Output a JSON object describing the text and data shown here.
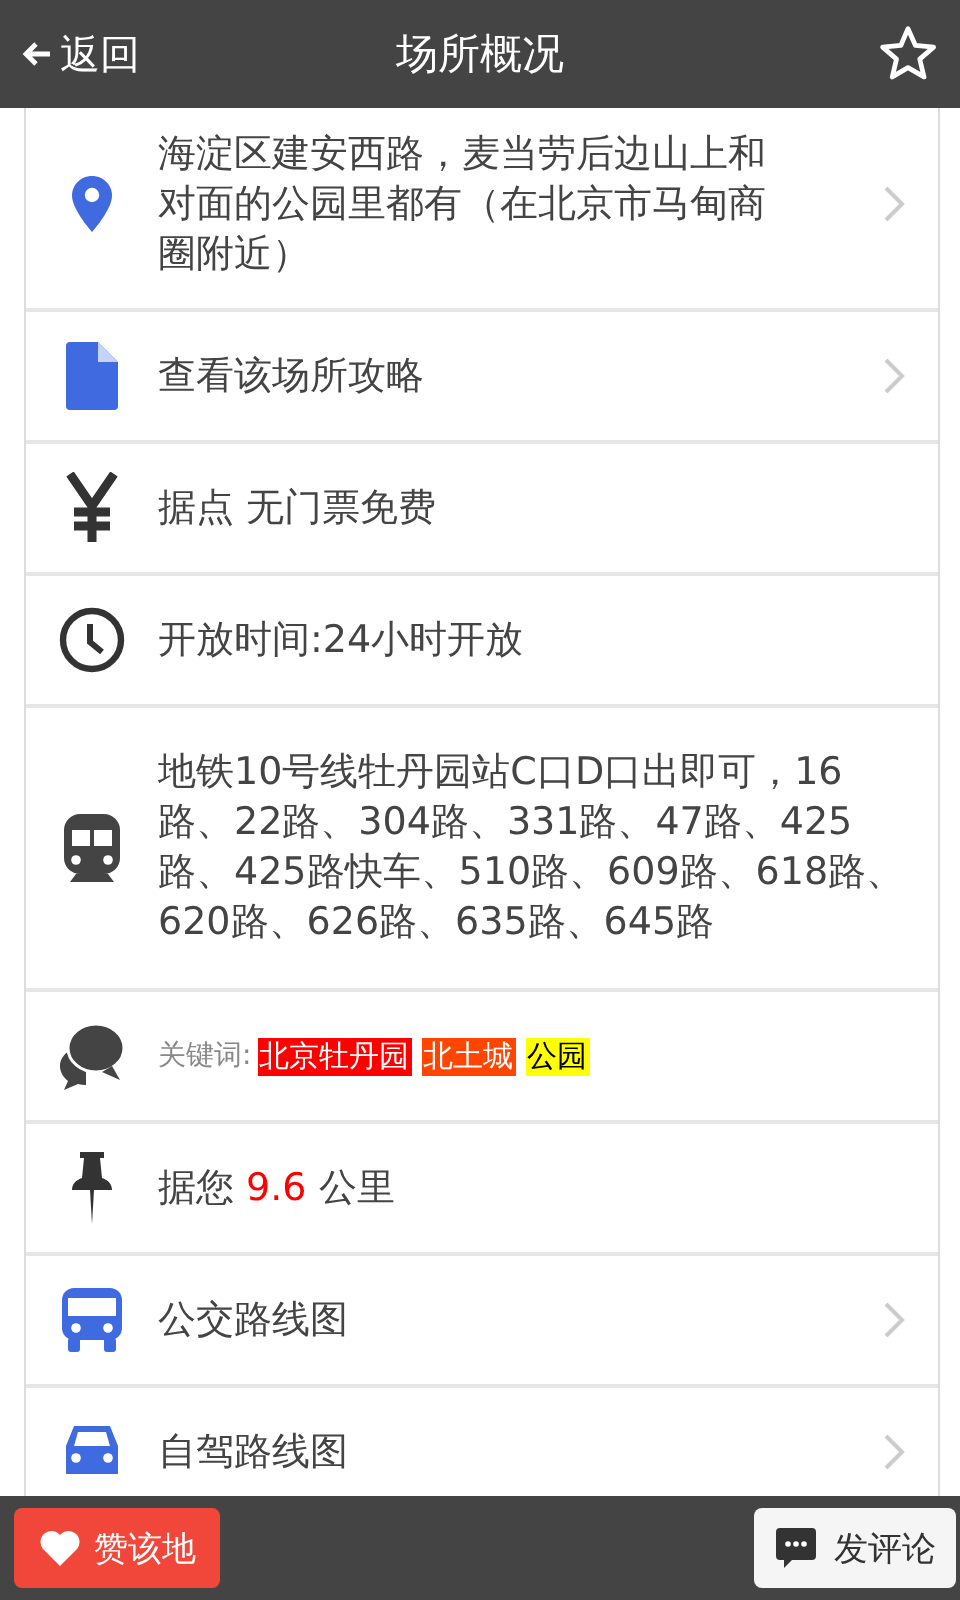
{
  "header": {
    "back": "返回",
    "title": "场所概况"
  },
  "rows": [
    {
      "kind": "address",
      "text": "海淀区建安西路，麦当劳后边山上和对面的公园里都有（在北京市马甸商圈附近）",
      "arrow": true
    },
    {
      "kind": "guide",
      "text": "查看该场所攻略",
      "arrow": true
    },
    {
      "kind": "price",
      "text": "据点 无门票免费",
      "arrow": false
    },
    {
      "kind": "hours",
      "text": "开放时间:24小时开放",
      "arrow": false
    },
    {
      "kind": "transit",
      "text": "地铁10号线牡丹园站C口D口出即可，16路、22路、304路、331路、47路、425路、425路快车、510路、609路、618路、620路、626路、635路、645路",
      "arrow": false
    },
    {
      "kind": "keywords",
      "label": "关键词:",
      "tags": [
        {
          "text": "北京牡丹园",
          "color": "#ff0000"
        },
        {
          "text": "北土城",
          "color": "#ff4500"
        },
        {
          "text": "公园",
          "color": "#ffff00"
        }
      ],
      "arrow": false
    },
    {
      "kind": "distance",
      "prefix": "据您",
      "value": "9.6",
      "suffix": "公里",
      "arrow": false
    },
    {
      "kind": "bus",
      "text": "公交路线图",
      "arrow": true
    },
    {
      "kind": "car",
      "text": "自驾路线图",
      "arrow": true
    }
  ],
  "footer": {
    "like": "赞该地",
    "comment": "发评论"
  }
}
